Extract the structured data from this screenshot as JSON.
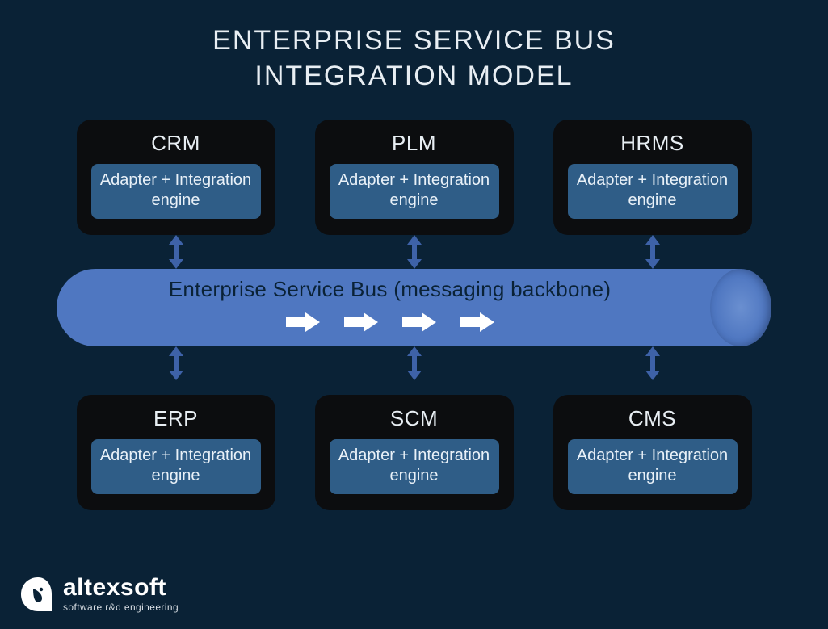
{
  "title_line1": "ENTERPRISE SERVICE BUS",
  "title_line2": "INTEGRATION MODEL",
  "adapter_label": "Adapter + Integration engine",
  "bus_label": "Enterprise Service Bus (messaging backbone)",
  "top_systems": [
    {
      "name": "CRM"
    },
    {
      "name": "PLM"
    },
    {
      "name": "HRMS"
    }
  ],
  "bottom_systems": [
    {
      "name": "ERP"
    },
    {
      "name": "SCM"
    },
    {
      "name": "CMS"
    }
  ],
  "logo": {
    "brand": "altexsoft",
    "tagline": "software r&d engineering"
  },
  "colors": {
    "bg": "#0a2236",
    "card": "#0c0d0f",
    "adapter": "#2f5d87",
    "bus": "#4f77c1",
    "connector": "#3e62a8"
  }
}
